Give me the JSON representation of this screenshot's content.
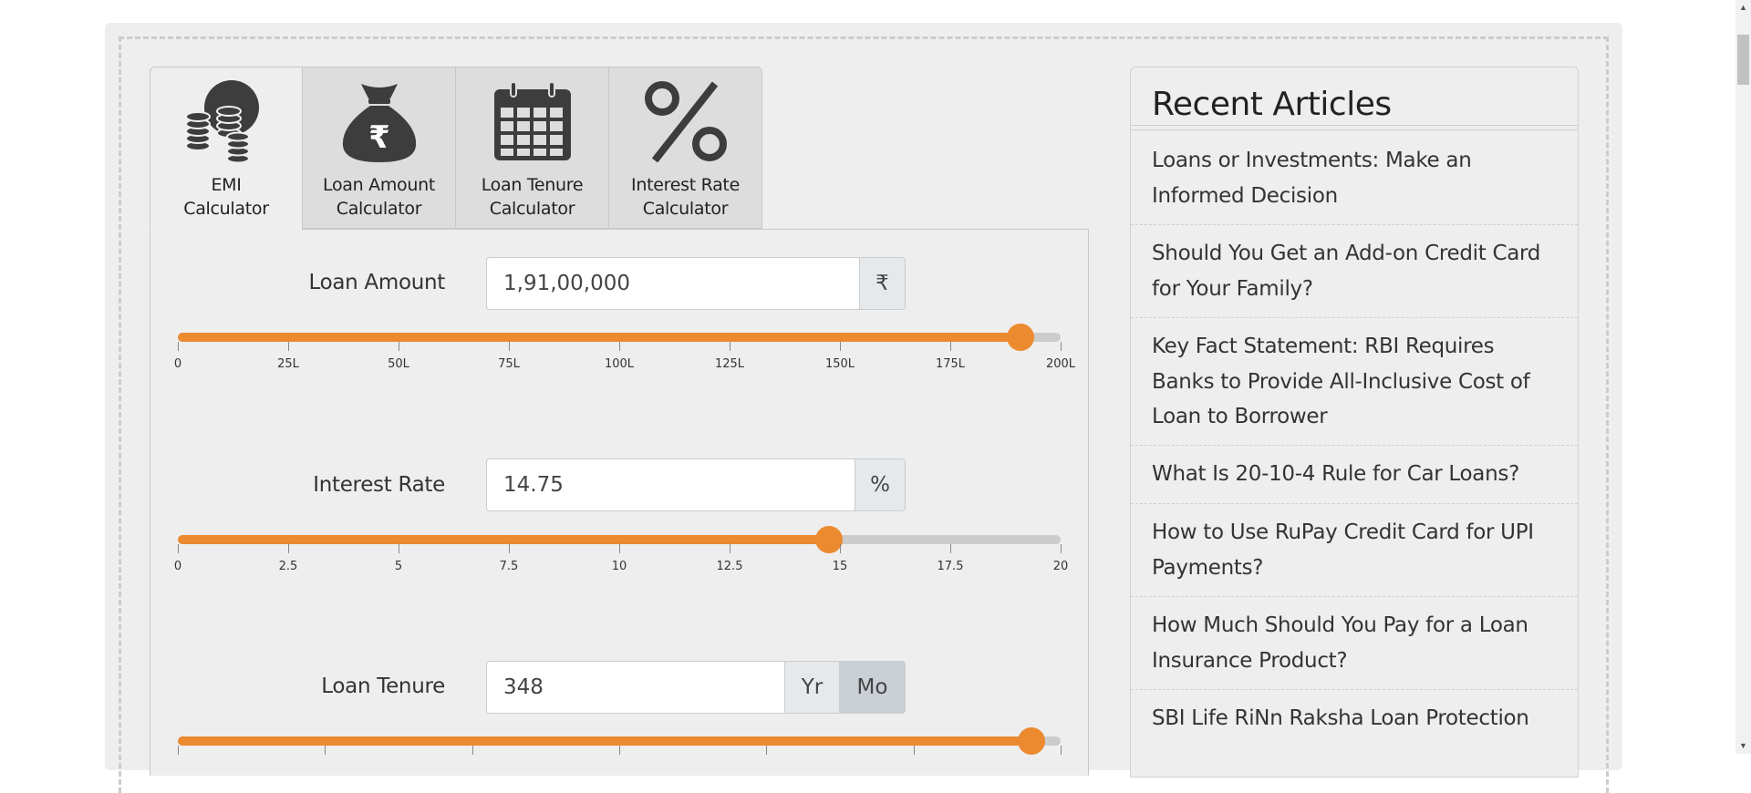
{
  "tabs": [
    {
      "label": "EMI Calculator",
      "icon": "coins-icon",
      "active": true
    },
    {
      "label": "Loan Amount Calculator",
      "icon": "money-bag-rupee-icon",
      "active": false
    },
    {
      "label": "Loan Tenure Calculator",
      "icon": "calendar-icon",
      "active": false
    },
    {
      "label": "Interest Rate Calculator",
      "icon": "percent-icon",
      "active": false
    }
  ],
  "loan_amount": {
    "label": "Loan Amount",
    "value": "1,91,00,000",
    "unit": "₹",
    "slider_fraction": 0.955,
    "ticks": [
      "0",
      "25L",
      "50L",
      "75L",
      "100L",
      "125L",
      "150L",
      "175L",
      "200L"
    ]
  },
  "interest_rate": {
    "label": "Interest Rate",
    "value": "14.75",
    "unit": "%",
    "slider_fraction": 0.7375,
    "ticks": [
      "0",
      "2.5",
      "5",
      "7.5",
      "10",
      "12.5",
      "15",
      "17.5",
      "20"
    ]
  },
  "loan_tenure": {
    "label": "Loan Tenure",
    "value": "348",
    "unit_year": "Yr",
    "unit_month": "Mo",
    "selected_unit": "Mo",
    "slider_fraction": 0.967
  },
  "sidebar": {
    "title": "Recent Articles",
    "articles": [
      "Loans or Investments: Make an Informed Decision",
      "Should You Get an Add-on Credit Card for Your Family?",
      "Key Fact Statement: RBI Requires Banks to Provide All-Inclusive Cost of Loan to Borrower",
      "What Is 20-10-4 Rule for Car Loans?",
      "How to Use RuPay Credit Card for UPI Payments?",
      "How Much Should You Pay for a Loan Insurance Product?",
      "SBI Life RiNn Raksha Loan Protection"
    ]
  },
  "colors": {
    "accent": "#ec8a30",
    "track": "#cccccc",
    "panel": "#eeeeee",
    "icon": "#3d3d3d"
  }
}
